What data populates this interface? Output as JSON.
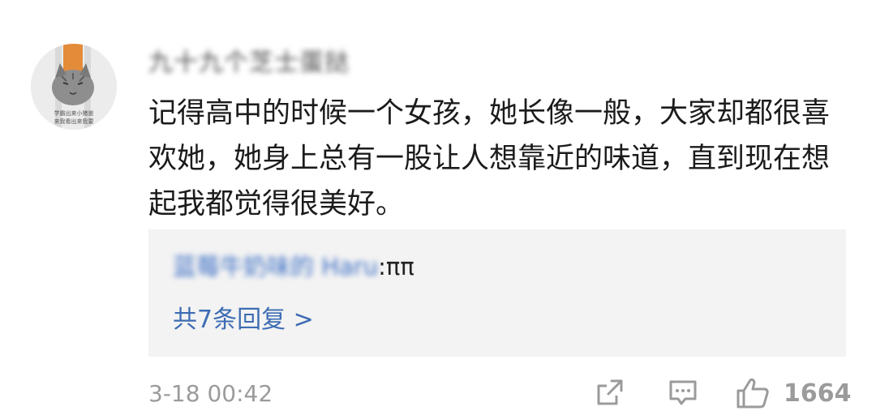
{
  "comment": {
    "username": "九十九个芝士蛋挞",
    "body": "记得高中的时候一个女孩，她长像一般，大家却都很喜欢她，她身上总有一股让人想靠近的味道，直到现在想起我都觉得很美好。",
    "avatar_caption_line1": "学霸出来小猪崽",
    "avatar_caption_line2": "来我看出来我要"
  },
  "reply_preview": {
    "author": "蓝莓牛奶味的 Haru",
    "colon": ": ",
    "text": "ππ",
    "more_label": "共7条回复 >"
  },
  "footer": {
    "timestamp": "3-18 00:42",
    "like_count": "1664"
  },
  "icons": {
    "share": "share-icon",
    "reply": "comment-icon",
    "like": "thumbs-up-icon"
  },
  "colors": {
    "link": "#3d6cb3",
    "muted": "#9b9b9b",
    "reply_bg": "#f3f3f3"
  }
}
